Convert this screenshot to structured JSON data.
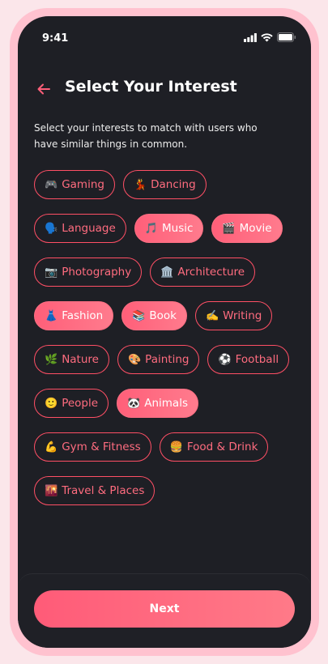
{
  "status_bar": {
    "time": "9:41"
  },
  "header": {
    "title": "Select Your Interest"
  },
  "description": "Select your interests to match with users who have similar things in common.",
  "interests": [
    {
      "emoji": "🎮",
      "label": "Gaming",
      "selected": false
    },
    {
      "emoji": "💃",
      "label": "Dancing",
      "selected": false
    },
    {
      "emoji": "🗣️",
      "label": "Language",
      "selected": false
    },
    {
      "emoji": "🎵",
      "label": "Music",
      "selected": true
    },
    {
      "emoji": "🎬",
      "label": "Movie",
      "selected": true
    },
    {
      "emoji": "📷",
      "label": "Photography",
      "selected": false
    },
    {
      "emoji": "🏛️",
      "label": "Architecture",
      "selected": false
    },
    {
      "emoji": "👗",
      "label": "Fashion",
      "selected": true
    },
    {
      "emoji": "📚",
      "label": "Book",
      "selected": true
    },
    {
      "emoji": "✍️",
      "label": "Writing",
      "selected": false
    },
    {
      "emoji": "🌿",
      "label": "Nature",
      "selected": false
    },
    {
      "emoji": "🎨",
      "label": "Painting",
      "selected": false
    },
    {
      "emoji": "⚽",
      "label": "Football",
      "selected": false
    },
    {
      "emoji": "🙂",
      "label": "People",
      "selected": false
    },
    {
      "emoji": "🐼",
      "label": "Animals",
      "selected": true
    },
    {
      "emoji": "💪",
      "label": "Gym & Fitness",
      "selected": false
    },
    {
      "emoji": "🍔",
      "label": "Food & Drink",
      "selected": false
    },
    {
      "emoji": "🌇",
      "label": "Travel & Places",
      "selected": false
    }
  ],
  "footer": {
    "next_label": "Next"
  },
  "colors": {
    "accent": "#ff5f79",
    "background": "#1e1f25",
    "frame": "#ffc2cf"
  }
}
